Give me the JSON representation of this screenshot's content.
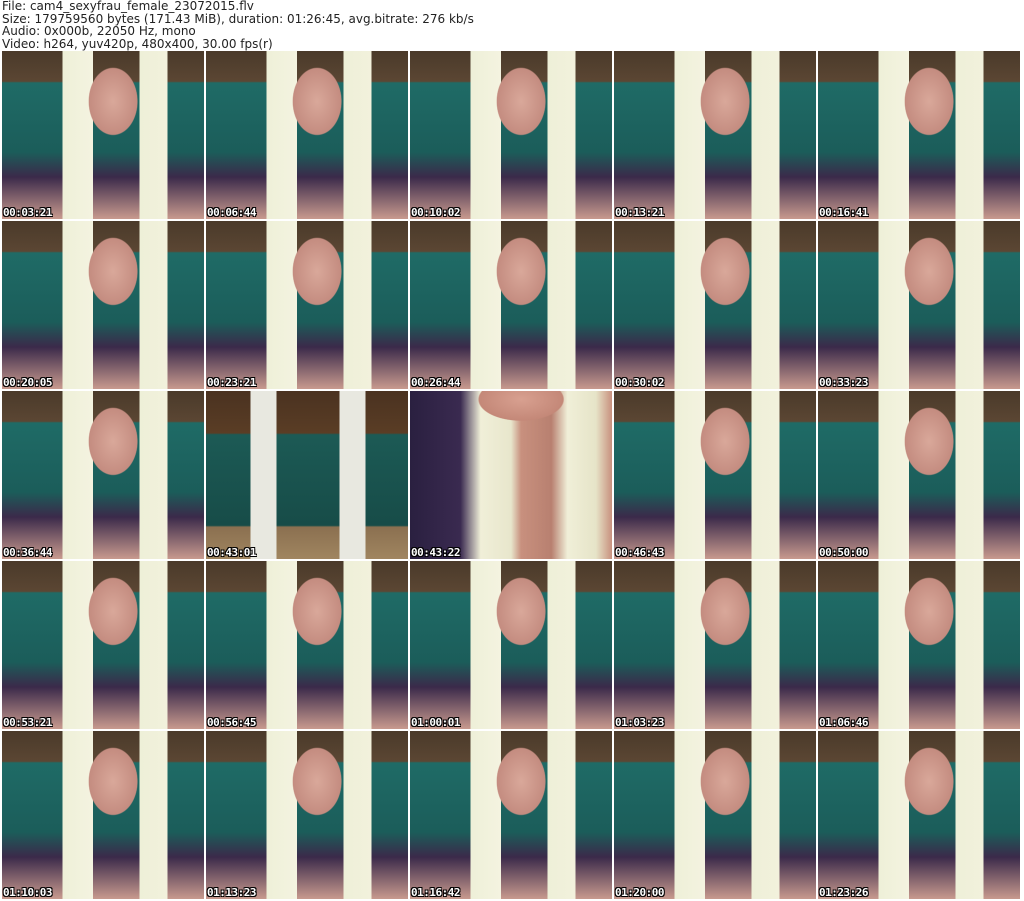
{
  "header": {
    "file": "File: cam4_sexyfrau_female_23072015.flv",
    "size": "Size: 179759560 bytes (171.43 MiB), duration: 01:26:45, avg.bitrate: 276 kb/s",
    "audio": "Audio: 0x000b, 22050 Hz, mono",
    "video": "Video: h264, yuv420p, 480x400, 30.00 fps(r)"
  },
  "thumbnails": [
    {
      "time": "00:03:21"
    },
    {
      "time": "00:06:44"
    },
    {
      "time": "00:10:02"
    },
    {
      "time": "00:13:21"
    },
    {
      "time": "00:16:41"
    },
    {
      "time": "00:20:05"
    },
    {
      "time": "00:23:21"
    },
    {
      "time": "00:26:44"
    },
    {
      "time": "00:30:02"
    },
    {
      "time": "00:33:23"
    },
    {
      "time": "00:36:44"
    },
    {
      "time": "00:43:01"
    },
    {
      "time": "00:43:22"
    },
    {
      "time": "00:46:43"
    },
    {
      "time": "00:50:00"
    },
    {
      "time": "00:53:21"
    },
    {
      "time": "00:56:45"
    },
    {
      "time": "01:00:01"
    },
    {
      "time": "01:03:23"
    },
    {
      "time": "01:06:46"
    },
    {
      "time": "01:10:03"
    },
    {
      "time": "01:13:23"
    },
    {
      "time": "01:16:42"
    },
    {
      "time": "01:20:00"
    },
    {
      "time": "01:23:26"
    }
  ]
}
